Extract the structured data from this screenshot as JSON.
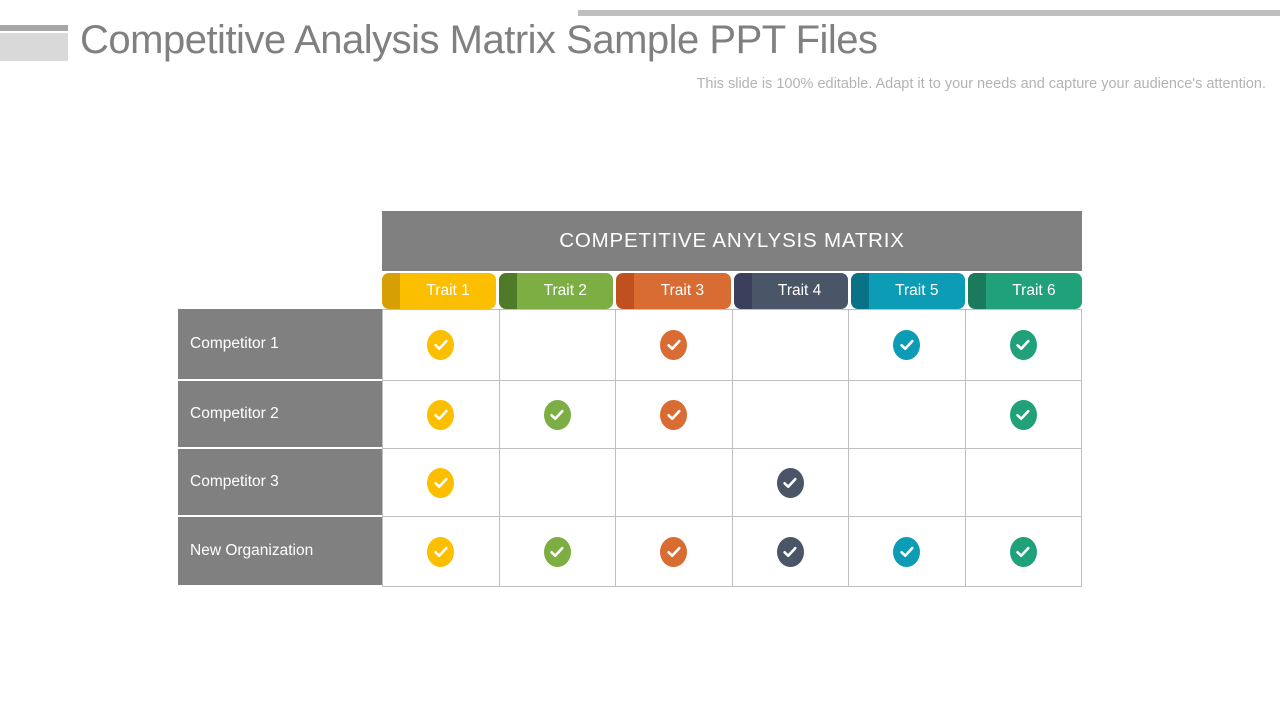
{
  "header": {
    "title": "Competitive Analysis Matrix Sample PPT Files",
    "subtitle": "This slide is 100% editable. Adapt it to your needs and capture your audience's attention."
  },
  "decor": {
    "top_rule_color": "#bfbfbf",
    "corner_bar_color": "#a6a6a6",
    "corner_block_color": "#d9d9d9"
  },
  "matrix": {
    "banner": "COMPETITIVE  ANYLYSIS  MATRIX",
    "banner_color": "#808080",
    "row_label_color": "#808080",
    "grid_line_color": "#bfbfbf",
    "columns": [
      {
        "label": "Trait 1",
        "color": "#fbbf00",
        "edge_color": "#d6a005"
      },
      {
        "label": "Trait 2",
        "color": "#7cae43",
        "edge_color": "#4f7a28"
      },
      {
        "label": "Trait 3",
        "color": "#d96c33",
        "edge_color": "#c0501f"
      },
      {
        "label": "Trait 4",
        "color": "#4a5568",
        "edge_color": "#3b3f5c"
      },
      {
        "label": "Trait 5",
        "color": "#0d9cb5",
        "edge_color": "#0a7287"
      },
      {
        "label": "Trait 6",
        "color": "#21a179",
        "edge_color": "#1b7a5c"
      }
    ],
    "rows": [
      {
        "label": "Competitor 1",
        "checks": [
          true,
          false,
          true,
          false,
          true,
          true
        ]
      },
      {
        "label": "Competitor 2",
        "checks": [
          true,
          true,
          true,
          false,
          false,
          true
        ]
      },
      {
        "label": "Competitor 3",
        "checks": [
          true,
          false,
          false,
          true,
          false,
          false
        ]
      },
      {
        "label": "New Organization",
        "checks": [
          true,
          true,
          true,
          true,
          true,
          true
        ]
      }
    ],
    "check_icon": "check-circle-icon"
  }
}
